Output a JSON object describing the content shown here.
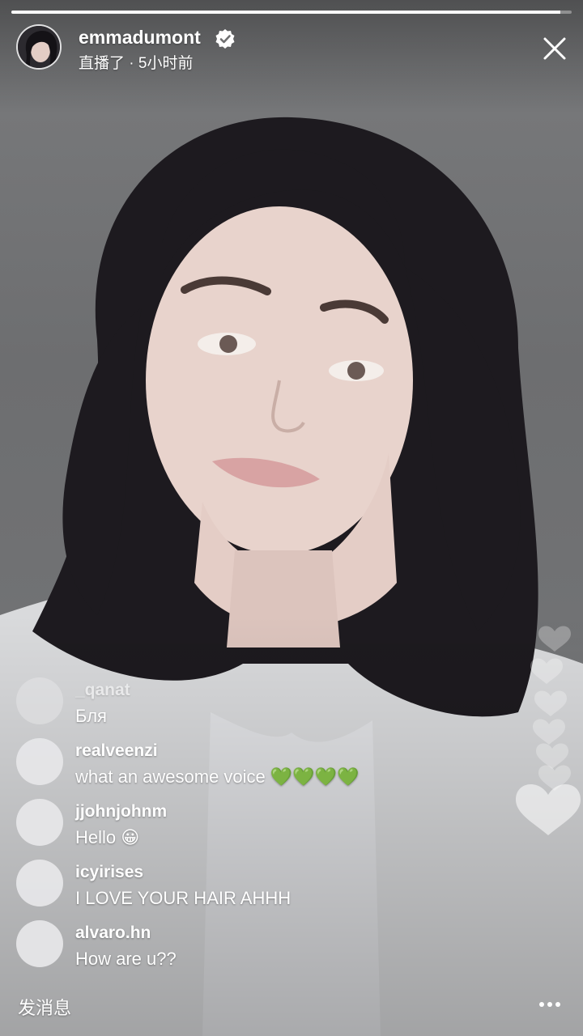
{
  "progress": 0.98,
  "header": {
    "username": "emmadumont",
    "status_text": "直播了 · 5小时前",
    "verified": true,
    "icons": [
      "verified-badge-icon",
      "close-icon"
    ]
  },
  "comments": [
    {
      "user": "_qanat",
      "text": "Бля"
    },
    {
      "user": "realveenzi",
      "text": "what an awesome voice 💚💚💚💚"
    },
    {
      "user": "jjohnjohnm",
      "text": "Hello 😀"
    },
    {
      "user": "icyirises",
      "text": "I LOVE YOUR HAIR AHHH"
    },
    {
      "user": "alvaro.hn",
      "text": "How are u??"
    }
  ],
  "footer": {
    "send_message_label": "发消息",
    "more_icon": "more-horizontal-icon"
  },
  "colors": {
    "text": "#ffffff",
    "avatar_placeholder": "#e6e6e8",
    "verified_badge": "#ffffff"
  }
}
